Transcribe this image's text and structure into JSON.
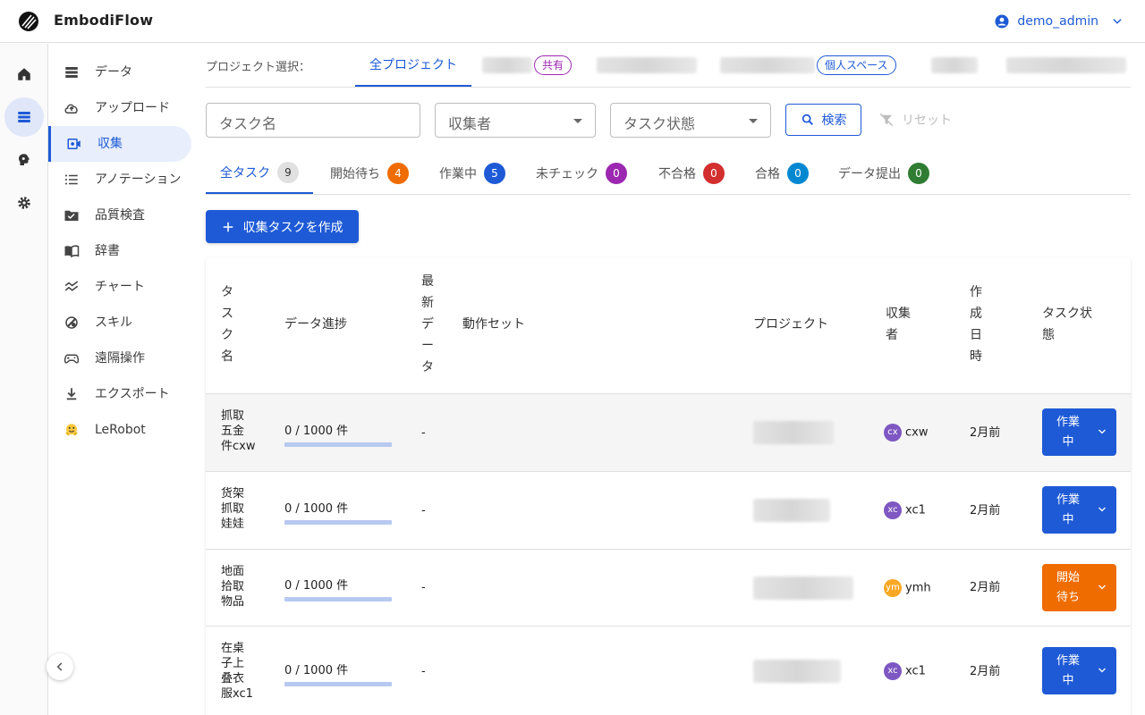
{
  "app": {
    "title": "EmbodiFlow",
    "user": "demo_admin"
  },
  "rail": [
    "home-icon",
    "list-icon",
    "brain-icon",
    "gear-icon"
  ],
  "sidebar": {
    "items": [
      {
        "label": "データ",
        "icon": "database-icon"
      },
      {
        "label": "アップロード",
        "icon": "upload-icon"
      },
      {
        "label": "収集",
        "icon": "video-icon"
      },
      {
        "label": "アノテーション",
        "icon": "list-icon"
      },
      {
        "label": "品質検査",
        "icon": "folder-check-icon"
      },
      {
        "label": "辞書",
        "icon": "book-icon"
      },
      {
        "label": "チャート",
        "icon": "chart-icon"
      },
      {
        "label": "スキル",
        "icon": "skill-icon"
      },
      {
        "label": "遠隔操作",
        "icon": "gamepad-icon"
      },
      {
        "label": "エクスポート",
        "icon": "download-icon"
      },
      {
        "label": "LeRobot",
        "icon": "hug-icon"
      }
    ]
  },
  "projects": {
    "label": "プロジェクト選択：",
    "all": "全プロジェクト",
    "chip_shared": "共有",
    "chip_personal": "個人スペース"
  },
  "filters": {
    "task_name_placeholder": "タスク名",
    "collector_placeholder": "収集者",
    "status_placeholder": "タスク状態",
    "search": "検索",
    "reset": "リセット"
  },
  "status_tabs": [
    {
      "label": "全タスク",
      "count": "9",
      "color": "#e0e0e0"
    },
    {
      "label": "開始待ち",
      "count": "4",
      "color": "#ef6c00"
    },
    {
      "label": "作業中",
      "count": "5",
      "color": "#1e5ad6"
    },
    {
      "label": "未チェック",
      "count": "0",
      "color": "#9c27b0"
    },
    {
      "label": "不合格",
      "count": "0",
      "color": "#d32f2f"
    },
    {
      "label": "合格",
      "count": "0",
      "color": "#0288d1"
    },
    {
      "label": "データ提出",
      "count": "0",
      "color": "#2e7d32"
    }
  ],
  "create_button": "収集タスクを作成",
  "table": {
    "headers": {
      "task_name": "タ\nス\nク\n名",
      "progress": "データ進捗",
      "latest": "最\n新\nデ\nー\nタ",
      "action_set": "動作セット",
      "project": "プロジェクト",
      "collector": "収集\n者",
      "created": "作\n成\n日\n時",
      "status": "タスク状\n態"
    },
    "rows": [
      {
        "name": "抓取\n五金\n件cxw",
        "progress": "0 / 1000 件",
        "progress_value": 0,
        "latest": "-",
        "avatar": "cx",
        "avatar_color": "#7e57c2",
        "collector": "cxw",
        "created": "2月前",
        "status": "作業\n中",
        "status_color": "#1e5ad6"
      },
      {
        "name": "货架\n抓取\n娃娃",
        "progress": "0 / 1000 件",
        "progress_value": 0,
        "latest": "-",
        "avatar": "xc",
        "avatar_color": "#7e57c2",
        "collector": "xc1",
        "created": "2月前",
        "status": "作業\n中",
        "status_color": "#1e5ad6"
      },
      {
        "name": "地面\n拾取\n物品",
        "progress": "0 / 1000 件",
        "progress_value": 0,
        "latest": "-",
        "avatar": "ym",
        "avatar_color": "#f9a825",
        "collector": "ymh",
        "created": "2月前",
        "status": "開始\n待ち",
        "status_color": "#ef6c00"
      },
      {
        "name": "在桌\n子上\n叠衣\n服xc1",
        "progress": "0 / 1000 件",
        "progress_value": 0,
        "latest": "-",
        "avatar": "xc",
        "avatar_color": "#7e57c2",
        "collector": "xc1",
        "created": "2月前",
        "status": "作業\n中",
        "status_color": "#1e5ad6"
      }
    ]
  }
}
